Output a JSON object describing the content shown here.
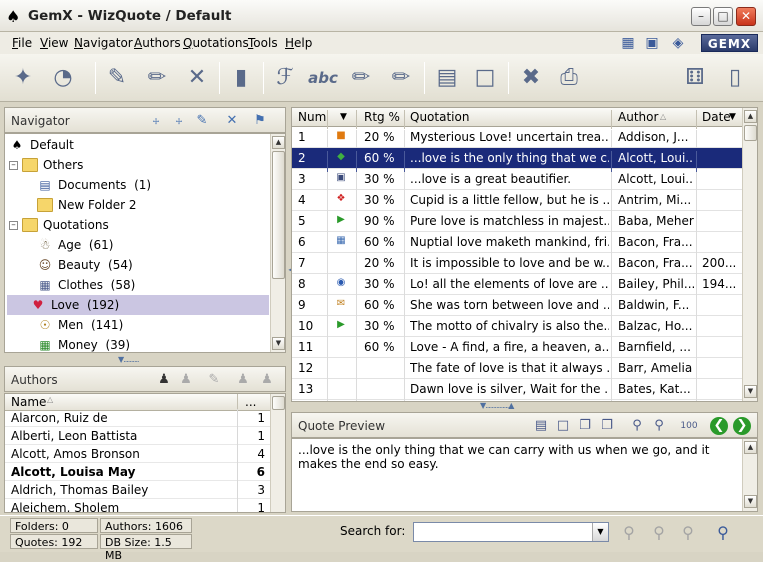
{
  "window": {
    "title": "GemX - WizQuote / Default"
  },
  "menu": [
    "File",
    "View",
    "Navigator",
    "Authors",
    "Quotations",
    "Tools",
    "Help"
  ],
  "logo": "GEMX",
  "navigator": {
    "title": "Navigator",
    "nodes": [
      {
        "label": "Default",
        "count": ""
      },
      {
        "label": "Others",
        "count": ""
      },
      {
        "label": "Documents",
        "count": "(1)"
      },
      {
        "label": "New Folder 2",
        "count": ""
      },
      {
        "label": "Quotations",
        "count": ""
      },
      {
        "label": "Age",
        "count": "(61)"
      },
      {
        "label": "Beauty",
        "count": "(54)"
      },
      {
        "label": "Clothes",
        "count": "(58)"
      },
      {
        "label": "Love",
        "count": "(192)"
      },
      {
        "label": "Men",
        "count": "(141)"
      },
      {
        "label": "Money",
        "count": "(39)"
      }
    ]
  },
  "authors": {
    "title": "Authors",
    "col_name": "Name",
    "col_count": "...",
    "rows": [
      {
        "name": "Alarcon, Ruiz de",
        "count": "1"
      },
      {
        "name": "Alberti, Leon Battista",
        "count": "1"
      },
      {
        "name": "Alcott, Amos Bronson",
        "count": "4"
      },
      {
        "name": "Alcott, Louisa May",
        "count": "6"
      },
      {
        "name": "Aldrich, Thomas Bailey",
        "count": "3"
      },
      {
        "name": "Aleichem, Sholem",
        "count": "1"
      }
    ]
  },
  "quotes": {
    "headers": {
      "num": "Num",
      "rtg": "Rtg %",
      "quotation": "Quotation",
      "author": "Author",
      "date": "Date"
    },
    "rows": [
      {
        "num": "1",
        "icon": "cube-icon",
        "rtg": "20 %",
        "quote": "Mysterious Love!  uncertain trea...",
        "author": "Addison, J...",
        "date": ""
      },
      {
        "num": "2",
        "icon": "diamond-arrow-icon",
        "rtg": "60 %",
        "quote": "...love is the only thing that we c...",
        "author": "Alcott, Loui...",
        "date": ""
      },
      {
        "num": "3",
        "icon": "frame-icon",
        "rtg": "30 %",
        "quote": "...love is a great beautifier.",
        "author": "Alcott, Loui...",
        "date": ""
      },
      {
        "num": "4",
        "icon": "lifebuoy-icon",
        "rtg": "30 %",
        "quote": "Cupid is a little fellow, but he is ...",
        "author": "Antrim, Mi...",
        "date": ""
      },
      {
        "num": "5",
        "icon": "play-icon",
        "rtg": "90 %",
        "quote": "Pure love is matchless in majest...",
        "author": "Baba, Meher",
        "date": ""
      },
      {
        "num": "6",
        "icon": "grid-icon",
        "rtg": "60 %",
        "quote": "Nuptial love maketh mankind, fri...",
        "author": "Bacon, Fra...",
        "date": ""
      },
      {
        "num": "7",
        "icon": "",
        "rtg": "20 %",
        "quote": "It is impossible to love and be w...",
        "author": "Bacon, Fra...",
        "date": "200..."
      },
      {
        "num": "8",
        "icon": "globe-icon",
        "rtg": "30 %",
        "quote": "Lo!  all the elements of love are ...",
        "author": "Bailey, Phil...",
        "date": "194..."
      },
      {
        "num": "9",
        "icon": "mail-icon",
        "rtg": "60 %",
        "quote": "She was torn between love and ...",
        "author": "Baldwin, F...",
        "date": ""
      },
      {
        "num": "10",
        "icon": "play-icon",
        "rtg": "30 %",
        "quote": "The motto of chivalry is also the...",
        "author": "Balzac, Ho...",
        "date": ""
      },
      {
        "num": "11",
        "icon": "",
        "rtg": "60 %",
        "quote": "Love - A find, a fire, a heaven, a...",
        "author": "Barnfield, ...",
        "date": ""
      },
      {
        "num": "12",
        "icon": "",
        "rtg": "",
        "quote": "The fate of love is that it always ...",
        "author": "Barr, Amelia",
        "date": ""
      },
      {
        "num": "13",
        "icon": "",
        "rtg": "",
        "quote": "Dawn love is silver, Wait for the ...",
        "author": "Bates, Kat...",
        "date": ""
      }
    ]
  },
  "preview": {
    "title": "Quote Preview",
    "text": "...love is the only thing that we can carry with us when we go, and it makes the end so easy."
  },
  "status": {
    "folders": "Folders: 0",
    "quotes": "Quotes: 192",
    "authors": "Authors: 1606",
    "dbsize": "DB Size: 1.5 MB",
    "search_label": "Search for:",
    "search_value": ""
  }
}
